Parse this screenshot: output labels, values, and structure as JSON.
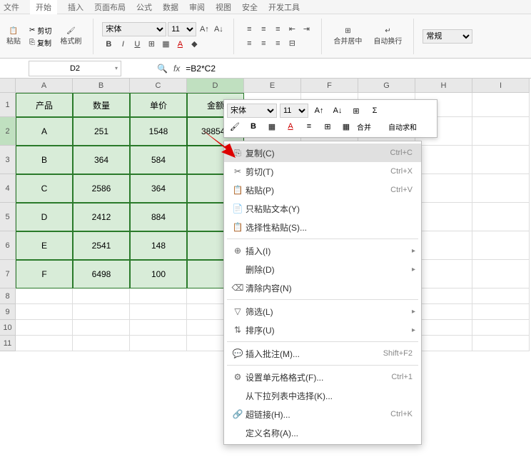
{
  "menu": {
    "file": "文件",
    "start": "开始",
    "insert": "插入",
    "layout": "页面布局",
    "formula": "公式",
    "data": "数据",
    "review": "审阅",
    "view": "视图",
    "security": "安全",
    "devtools": "开发工具"
  },
  "ribbon": {
    "cut": "剪切",
    "paste": "粘贴",
    "copy": "复制",
    "format_painter": "格式刷",
    "font_name": "宋体",
    "font_size": "11",
    "merge_center": "合并居中",
    "wrap_text": "自动换行",
    "general": "常规"
  },
  "namebox": "D2",
  "formula": "=B2*C2",
  "columns": [
    "A",
    "B",
    "C",
    "D",
    "E",
    "F",
    "G",
    "H",
    "I"
  ],
  "rows_visible": [
    "1",
    "2",
    "3",
    "4",
    "5",
    "6",
    "7",
    "8",
    "9",
    "10",
    "11"
  ],
  "table": {
    "headers": {
      "a": "产品",
      "b": "数量",
      "c": "单价",
      "d": "金额"
    },
    "rows": [
      {
        "a": "A",
        "b": "251",
        "c": "1548",
        "d": "388548"
      },
      {
        "a": "B",
        "b": "364",
        "c": "584",
        "d": ""
      },
      {
        "a": "C",
        "b": "2586",
        "c": "364",
        "d": ""
      },
      {
        "a": "D",
        "b": "2412",
        "c": "884",
        "d": ""
      },
      {
        "a": "E",
        "b": "2541",
        "c": "148",
        "d": ""
      },
      {
        "a": "F",
        "b": "6498",
        "c": "100",
        "d": ""
      }
    ]
  },
  "mini": {
    "font_name": "宋体",
    "font_size": "11",
    "merge": "合并",
    "autosum": "自动求和"
  },
  "ctx": {
    "copy": "复制(C)",
    "copy_k": "Ctrl+C",
    "cut": "剪切(T)",
    "cut_k": "Ctrl+X",
    "paste": "粘贴(P)",
    "paste_k": "Ctrl+V",
    "paste_text": "只粘贴文本(Y)",
    "paste_special": "选择性粘贴(S)...",
    "insert": "插入(I)",
    "delete": "删除(D)",
    "clear": "清除内容(N)",
    "filter": "筛选(L)",
    "sort": "排序(U)",
    "insert_comment": "插入批注(M)...",
    "insert_comment_k": "Shift+F2",
    "format_cells": "设置单元格格式(F)...",
    "format_cells_k": "Ctrl+1",
    "dropdown": "从下拉列表中选择(K)...",
    "hyperlink": "超链接(H)...",
    "hyperlink_k": "Ctrl+K",
    "define_name": "定义名称(A)..."
  }
}
